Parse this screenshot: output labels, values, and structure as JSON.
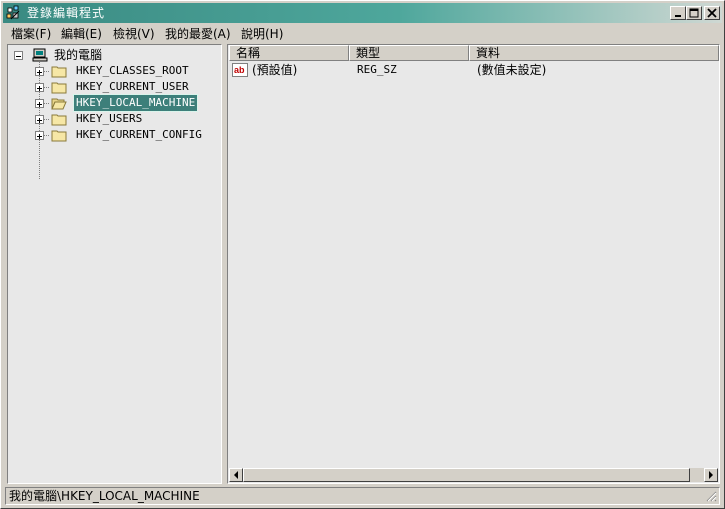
{
  "window": {
    "title": "登錄編輯程式"
  },
  "menu": {
    "items": [
      {
        "label": "檔案(F)"
      },
      {
        "label": "編輯(E)"
      },
      {
        "label": "檢視(V)"
      },
      {
        "label": "我的最愛(A)"
      },
      {
        "label": "說明(H)"
      }
    ]
  },
  "tree": {
    "root": {
      "label": "我的電腦",
      "icon": "computer-icon"
    },
    "children": [
      {
        "label": "HKEY_CLASSES_ROOT",
        "icon": "folder-icon",
        "selected": false
      },
      {
        "label": "HKEY_CURRENT_USER",
        "icon": "folder-icon",
        "selected": false
      },
      {
        "label": "HKEY_LOCAL_MACHINE",
        "icon": "folder-open-icon",
        "selected": true
      },
      {
        "label": "HKEY_USERS",
        "icon": "folder-icon",
        "selected": false
      },
      {
        "label": "HKEY_CURRENT_CONFIG",
        "icon": "folder-icon",
        "selected": false
      }
    ]
  },
  "list": {
    "columns": [
      "名稱",
      "類型",
      "資料"
    ],
    "rows": [
      {
        "name": "(預設值)",
        "type": "REG_SZ",
        "data": "(數值未設定)",
        "icon": "string-value-icon"
      }
    ]
  },
  "status": {
    "text": "我的電腦\\HKEY_LOCAL_MACHINE"
  },
  "colors": {
    "titlebar_start": "#3a8a82",
    "selection": "#3d7f7a",
    "pane_background": "#e8e8e8",
    "chrome": "#d4d0c8"
  }
}
